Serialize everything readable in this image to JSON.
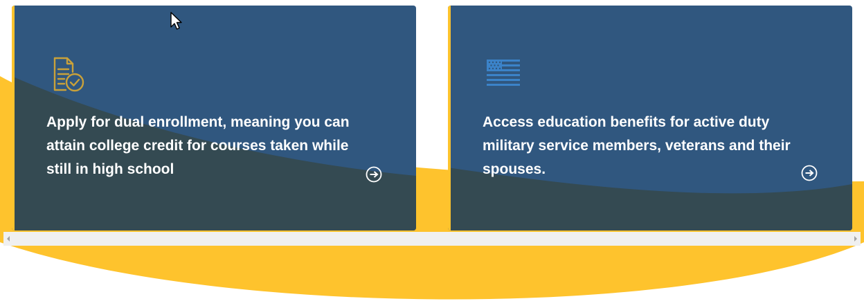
{
  "colors": {
    "card_blue": "#30577f",
    "card_overlay": "#344a52",
    "accent_yellow": "#fec32d",
    "icon_gold": "#c9a13a",
    "icon_blue": "#3b83c9",
    "text_white": "#ffffff",
    "scrollbar_bg": "#f0f0f0"
  },
  "cards": [
    {
      "icon": "document-check-icon",
      "text": "Apply for dual enrollment, meaning you can attain college credit for courses taken while still in high school",
      "arrow_icon": "arrow-right-circle-icon"
    },
    {
      "icon": "us-flag-icon",
      "text": "Access education benefits for active duty military service members, veterans and their spouses.",
      "arrow_icon": "arrow-right-circle-icon"
    }
  ],
  "scrollbar": {
    "orientation": "horizontal"
  }
}
